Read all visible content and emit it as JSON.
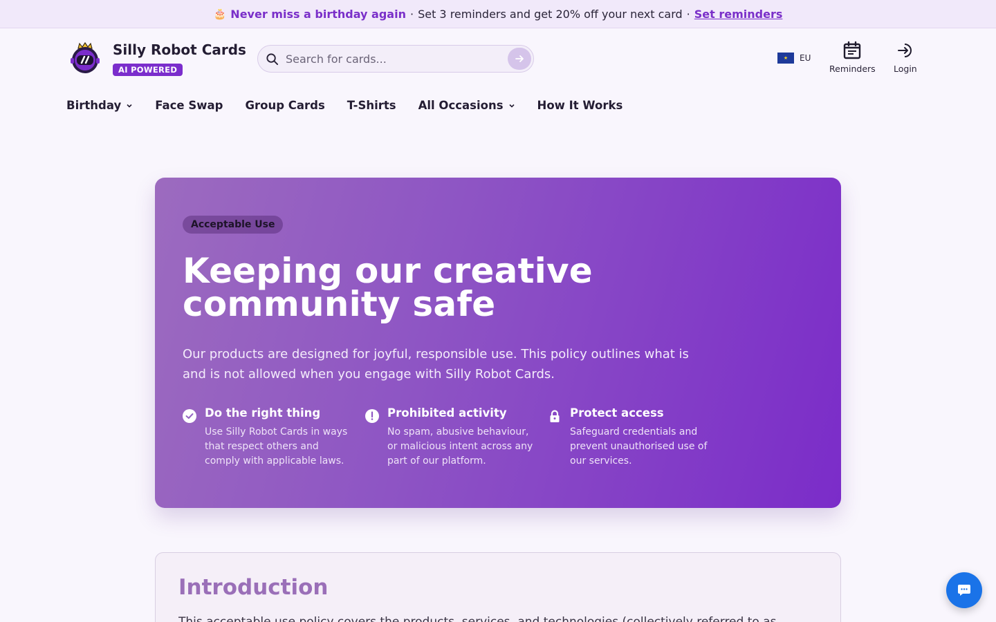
{
  "promo": {
    "emoji": "🎂",
    "highlight": "Never miss a birthday again",
    "separator": "·",
    "text": "Set 3 reminders and get 20% off your next card",
    "link": "Set reminders"
  },
  "header": {
    "brand": "Silly Robot Cards",
    "badge": "AI POWERED",
    "search_placeholder": "Search for cards...",
    "region": "EU",
    "reminders_label": "Reminders",
    "login_label": "Login"
  },
  "nav": {
    "items": [
      {
        "label": "Birthday",
        "dropdown": true
      },
      {
        "label": "Face Swap",
        "dropdown": false
      },
      {
        "label": "Group Cards",
        "dropdown": false
      },
      {
        "label": "T-Shirts",
        "dropdown": false
      },
      {
        "label": "All Occasions",
        "dropdown": true
      },
      {
        "label": "How It Works",
        "dropdown": false
      }
    ]
  },
  "hero": {
    "tag": "Acceptable Use",
    "title_line1": "Keeping our creative",
    "title_line2": "community safe",
    "description": "Our products are designed for joyful, responsible use. This policy outlines what is and is not allowed when you engage with Silly Robot Cards.",
    "features": [
      {
        "icon": "check-circle-icon",
        "title": "Do the right thing",
        "text": "Use Silly Robot Cards in ways that respect others and comply with applicable laws."
      },
      {
        "icon": "alert-circle-icon",
        "title": "Prohibited activity",
        "text": "No spam, abusive behaviour, or malicious intent across any part of our platform."
      },
      {
        "icon": "lock-icon",
        "title": "Protect access",
        "text": "Safeguard credentials and prevent unauthorised use of our services."
      }
    ]
  },
  "intro": {
    "title": "Introduction",
    "text": "This acceptable use policy covers the products, services, and technologies (collectively referred to as"
  },
  "colors": {
    "accent": "#7b2dcc",
    "chat": "#1a73e8"
  }
}
